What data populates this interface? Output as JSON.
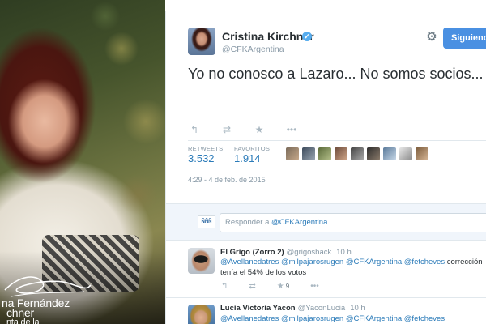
{
  "profile_photo": {
    "caption_line1": "na Fernández",
    "caption_line2": "chner",
    "caption_line3": "nta de la"
  },
  "tweet": {
    "author_name": "Cristina Kirchner",
    "author_handle": "@CFKArgentina",
    "verified": true,
    "follow_label": "Siguiendo",
    "text": "Yo no conosco a Lazaro... No somos socios...",
    "retweets_label": "RETWEETS",
    "retweets_count": "3.532",
    "favorites_label": "FAVORITOS",
    "favorites_count": "1.914",
    "timestamp": "4:29 - 4 de feb. de 2015",
    "actions": [
      "reply-icon",
      "retweet-icon",
      "favorite-icon",
      "more-icon"
    ]
  },
  "reply_box": {
    "avatar_text": "ÑÑÑ",
    "prompt": "Responder a ",
    "mention": "@CFKArgentina"
  },
  "replies": [
    {
      "name": "El Grigo (Zorro 2)",
      "handle": "@grigosback",
      "time": "10 h",
      "mentions": "@Avellanedatres @milpajarosrugen @CFKArgentina @fetcheves",
      "text_rest": " corrección",
      "line2": "tenía el 54% de los votos",
      "retweet_count": "9"
    },
    {
      "name": "Lucía Victoria Yacon",
      "handle": "@YaconLucia",
      "time": "10 h",
      "mentions": "@Avellanedatres @milpajarosrugen @CFKArgentina @fetcheves"
    }
  ],
  "colors": {
    "link": "#2b7bb9",
    "follow_button": "#4a90e2",
    "verified": "#55acee"
  }
}
